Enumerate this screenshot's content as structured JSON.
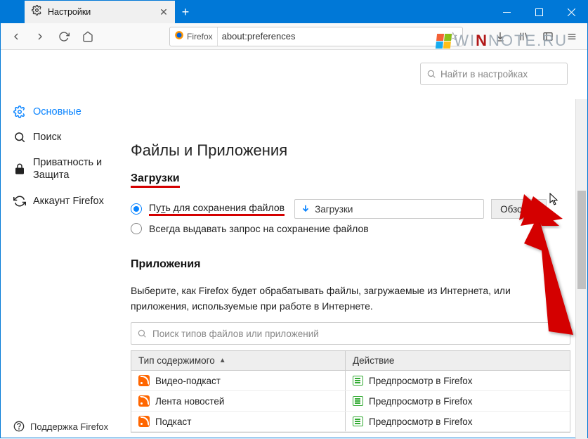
{
  "tab": {
    "title": "Настройки"
  },
  "urlbar": {
    "brand": "Firefox",
    "address": "about:preferences"
  },
  "watermark": {
    "pre": "WI",
    "n": "N",
    "post": "NOTE.RU"
  },
  "search_settings": {
    "placeholder": "Найти в настройках"
  },
  "sidebar": {
    "items": [
      {
        "label": "Основные"
      },
      {
        "label": "Поиск"
      },
      {
        "label": "Приватность и Защита"
      },
      {
        "label": "Аккаунт Firefox"
      }
    ],
    "support": "Поддержка Firefox"
  },
  "main": {
    "section_title": "Файлы и Приложения",
    "downloads": {
      "heading": "Загрузки",
      "save_path_label_pre": "Пу",
      "save_path_label_under": "т",
      "save_path_label_post": "ь для сохранения файлов",
      "folder": "Загрузки",
      "browse": "Обзор…",
      "always_ask": "Всегда выдавать запрос на сохранение файлов"
    },
    "apps": {
      "heading": "Приложения",
      "desc": "Выберите, как Firefox будет обрабатывать файлы, загружаемые из Интернета, или приложения, используемые при работе в Интернете.",
      "search_placeholder": "Поиск типов файлов или приложений",
      "col1": "Тип содержимого",
      "col2": "Действие",
      "rows": [
        {
          "type": "Видео-подкаст",
          "action": "Предпросмотр в Firefox"
        },
        {
          "type": "Лента новостей",
          "action": "Предпросмотр в Firefox"
        },
        {
          "type": "Подкаст",
          "action": "Предпросмотр в Firefox"
        }
      ]
    }
  }
}
